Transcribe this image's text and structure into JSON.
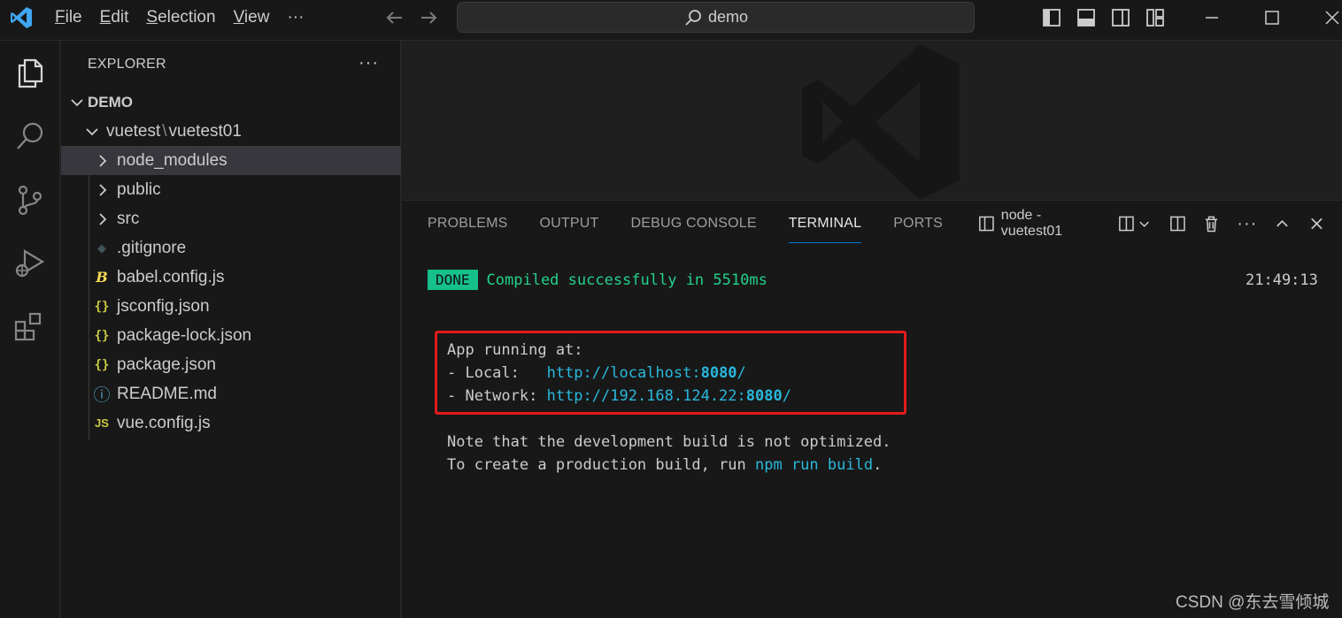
{
  "titlebar": {
    "menu": [
      {
        "underline": "F",
        "rest": "ile"
      },
      {
        "underline": "E",
        "rest": "dit"
      },
      {
        "underline": "S",
        "rest": "election"
      },
      {
        "underline": "V",
        "rest": "iew"
      }
    ],
    "more": "···",
    "search_text": "demo"
  },
  "sidebar": {
    "header": "EXPLORER",
    "more": "···",
    "root": "DEMO",
    "folder_path": {
      "part1": "vuetest",
      "sep": "\\",
      "part2": "vuetest01"
    },
    "items": [
      {
        "label": "node_modules",
        "type": "folder"
      },
      {
        "label": "public",
        "type": "folder"
      },
      {
        "label": "src",
        "type": "folder"
      },
      {
        "label": ".gitignore",
        "type": "git",
        "icon_glyph": "◆"
      },
      {
        "label": "babel.config.js",
        "type": "babel",
        "icon_glyph": "B"
      },
      {
        "label": "jsconfig.json",
        "type": "json",
        "icon_glyph": "{}"
      },
      {
        "label": "package-lock.json",
        "type": "json",
        "icon_glyph": "{}"
      },
      {
        "label": "package.json",
        "type": "json",
        "icon_glyph": "{}"
      },
      {
        "label": "README.md",
        "type": "info",
        "icon_glyph": "ⓘ"
      },
      {
        "label": "vue.config.js",
        "type": "js",
        "icon_glyph": "JS"
      }
    ]
  },
  "panel": {
    "tabs": [
      "PROBLEMS",
      "OUTPUT",
      "DEBUG CONSOLE",
      "TERMINAL",
      "PORTS"
    ],
    "active_tab": "TERMINAL",
    "terminal_name": "node - vuetest01",
    "more": "···"
  },
  "terminal": {
    "done_badge": "DONE",
    "done_text": "Compiled successfully in 5510ms",
    "time": "21:49:13",
    "app_running": "App running at:",
    "local_label": "- Local:   ",
    "local_url_prefix": "http://localhost:",
    "local_port": "8080",
    "local_url_suffix": "/",
    "network_label": "- Network: ",
    "network_url_prefix": "http://192.168.124.22:",
    "network_port": "8080",
    "network_url_suffix": "/",
    "note1": "Note that the development build is not optimized.",
    "note2_prefix": "To create a production build, run ",
    "note2_cmd": "npm run build",
    "note2_suffix": "."
  },
  "watermark_text": "CSDN @东去雪倾城",
  "colors": {
    "accent": "#0078d4",
    "done_green": "#16c08a",
    "link_cyan": "#29b8db",
    "highlight_red": "#e21b1b"
  }
}
